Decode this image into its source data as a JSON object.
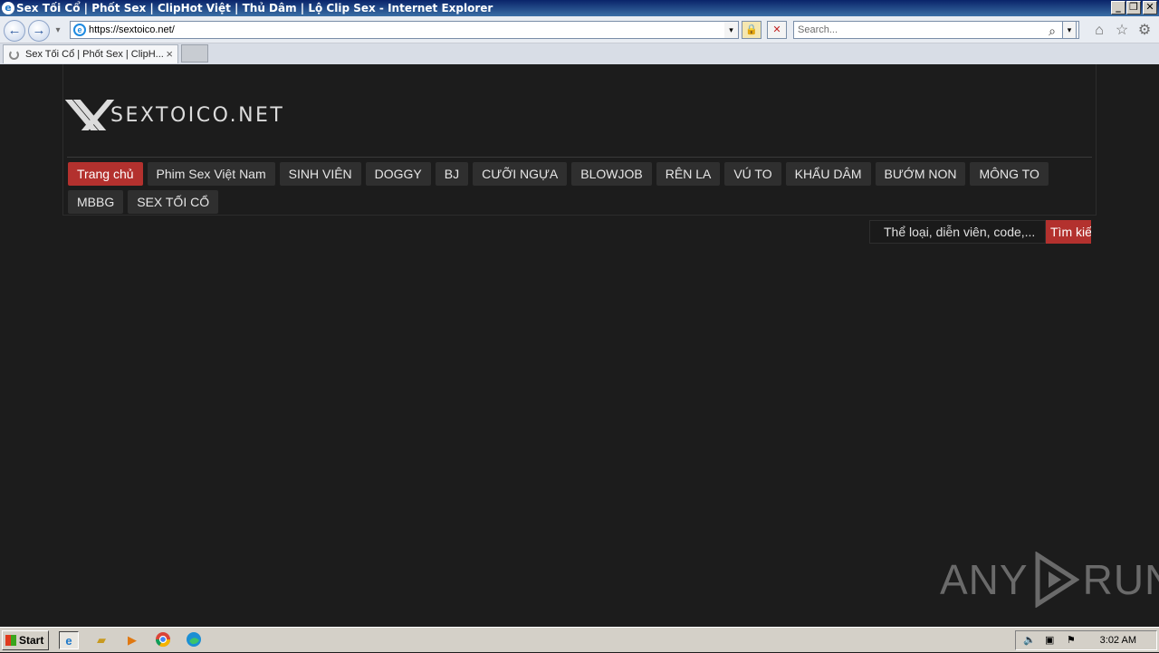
{
  "window": {
    "title": "Sex Tối Cổ | Phốt Sex | ClipHot Việt | Thủ Dâm | Lộ Clip Sex - Internet Explorer",
    "minimize": "_",
    "restore": "❐",
    "close": "✕"
  },
  "navbar": {
    "back": "←",
    "forward": "→",
    "address": "https://sextoico.net/",
    "dropdown": "▾",
    "lock": "🔒",
    "stop": "✕",
    "search_placeholder": "Search...",
    "search_icon": "⌕",
    "home": "⌂",
    "favorites": "☆",
    "tools": "⚙"
  },
  "tabs": [
    {
      "label": "Sex Tối Cổ | Phốt Sex | ClipH...",
      "close": "×"
    }
  ],
  "site": {
    "logo_text": "SEXTOICO.NET",
    "menu": [
      {
        "label": "Trang chủ",
        "active": true
      },
      {
        "label": "Phim Sex Việt Nam"
      },
      {
        "label": "SINH VIÊN"
      },
      {
        "label": "DOGGY"
      },
      {
        "label": "BJ"
      },
      {
        "label": "CƯỠI NGỰA"
      },
      {
        "label": "BLOWJOB"
      },
      {
        "label": "RÊN LA"
      },
      {
        "label": "VÚ TO"
      },
      {
        "label": "KHẨU DÂM"
      },
      {
        "label": "BƯỚM NON"
      },
      {
        "label": "MÔNG TO"
      },
      {
        "label": "MBBG"
      },
      {
        "label": "SEX TỐI CỔ"
      }
    ],
    "search": {
      "placeholder": "Thể loại, diễn viên, code,...",
      "button": "Tìm kiếm"
    },
    "colors": {
      "accent": "#b3312e",
      "background": "#1c1c1c",
      "menu_bg": "#2f2f2f"
    }
  },
  "watermark": {
    "left": "ANY",
    "right": "RUN"
  },
  "taskbar": {
    "start": "Start",
    "clock": "3:02 AM",
    "icons": [
      "ie-icon",
      "folder-icon",
      "media-player-icon",
      "chrome-icon",
      "edge-icon"
    ]
  }
}
